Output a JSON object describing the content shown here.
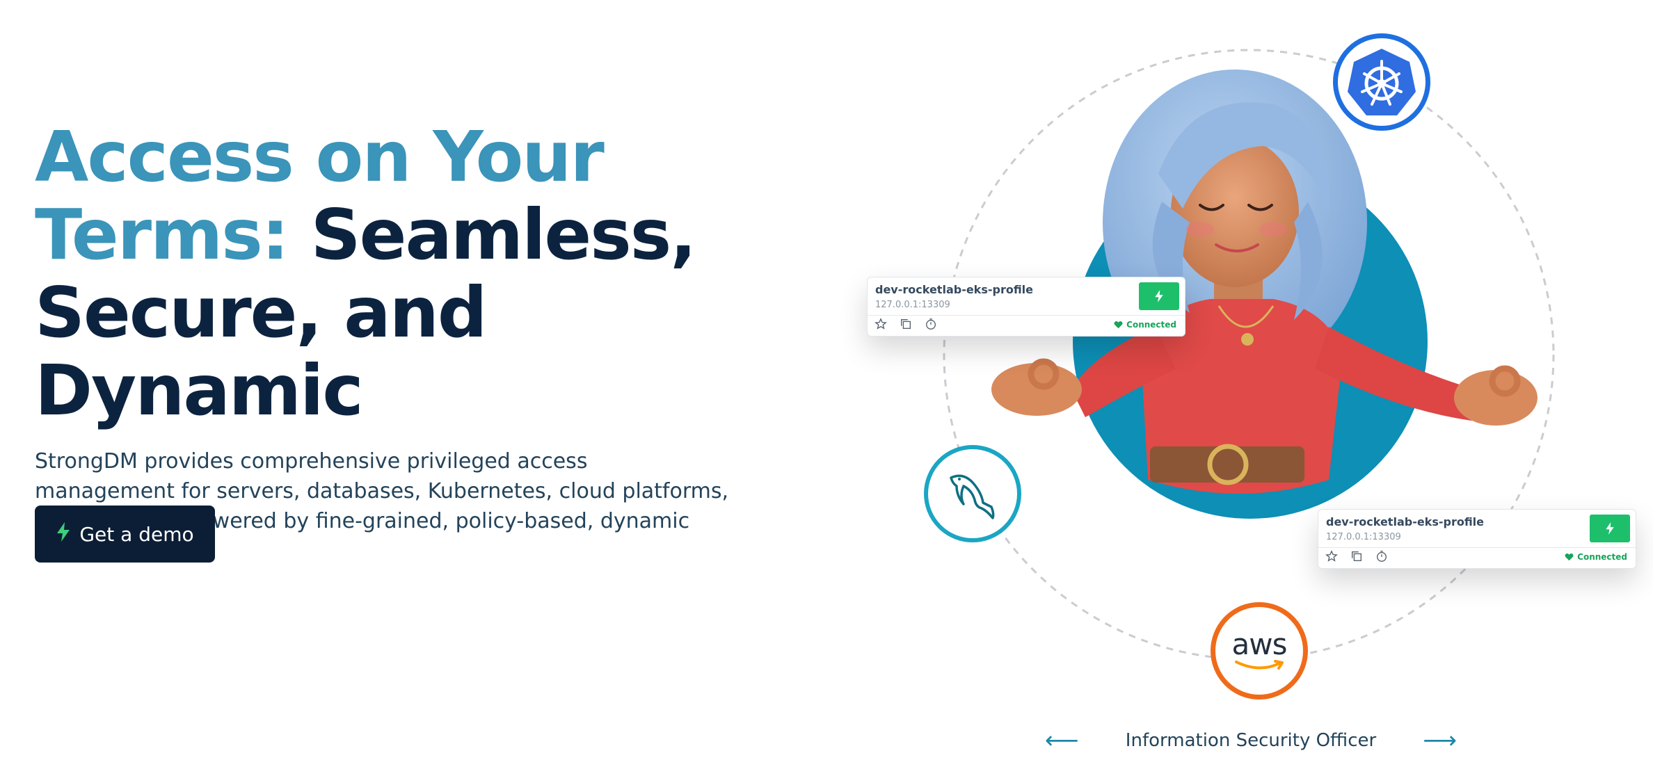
{
  "hero": {
    "headline_accent": "Access on Your Terms:",
    "headline_main": "Seamless, Secure, and Dynamic",
    "description": "StrongDM provides comprehensive privileged access management for servers, databases, Kubernetes, cloud platforms, and more—all powered by fine-grained, policy-based, dynamic authorization.",
    "cta_label": "Get a demo",
    "cta_icon": "lightning-bolt-icon"
  },
  "resource_cards": [
    {
      "name": "dev-rocketlab-eks-profile",
      "address": "127.0.0.1:13309",
      "status": "Connected"
    },
    {
      "name": "dev-rocketlab-eks-profile",
      "address": "127.0.0.1:13309",
      "status": "Connected"
    }
  ],
  "integrations": {
    "kubernetes": "kubernetes-logo",
    "mysql": "mysql-dolphin-logo",
    "aws": "aws"
  },
  "carousel": {
    "prev_icon": "arrow-left-icon",
    "role": "Information Security Officer",
    "next_icon": "arrow-right-icon"
  },
  "colors": {
    "navy": "#0c2340",
    "accent_blue": "#3b94b9",
    "button_bg": "#0c1e35",
    "connect_green": "#1dbf6b",
    "teal_disc": "#0d8fb6",
    "kubernetes_blue": "#1e6fe0",
    "mysql_teal": "#1aa6c4",
    "aws_orange": "#ef6b1a"
  }
}
